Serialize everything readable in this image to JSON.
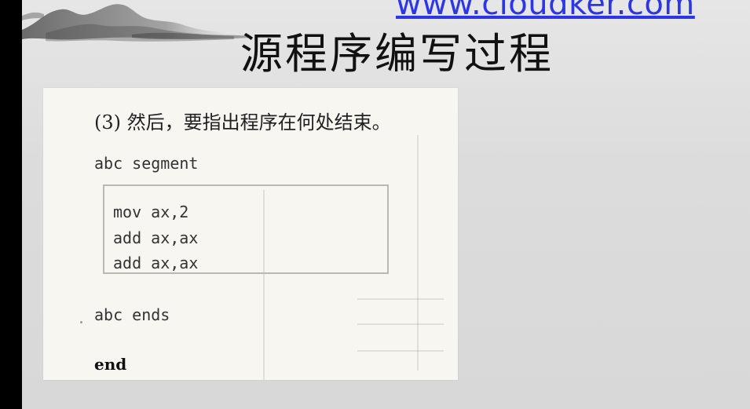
{
  "watermark": {
    "url_text": "www.cloudker.com",
    "color": "#2b36e8"
  },
  "slide": {
    "title": "源程序编写过程",
    "decoration": "ink-mountain-landscape"
  },
  "scan": {
    "caption": "(3)  然后，要指出程序在何处结束。",
    "code_lines": [
      "abc segment",
      "mov ax,2",
      "add ax,ax",
      "add ax,ax",
      "abc ends",
      "end"
    ]
  }
}
